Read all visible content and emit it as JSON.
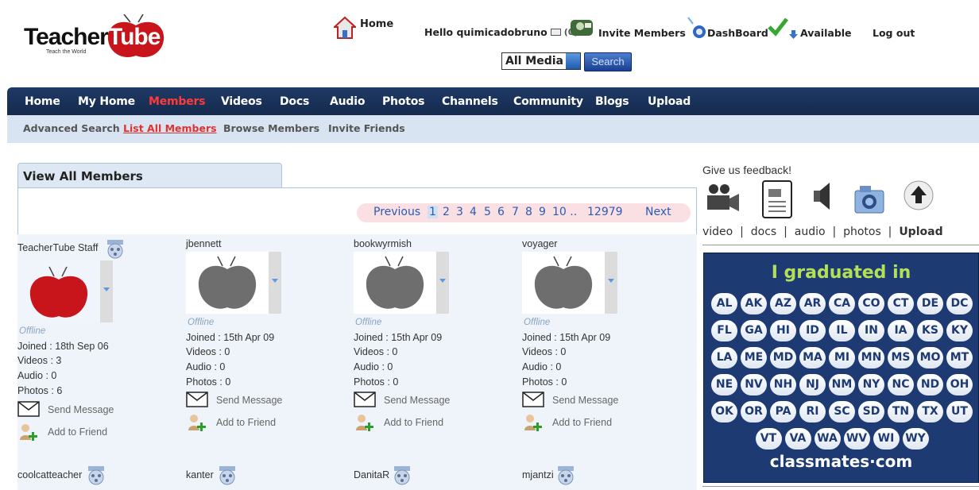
{
  "logo": {
    "text": "Teacher",
    "tube": "Tube",
    "tagline": "Teach the World"
  },
  "header": {
    "home": "Home",
    "hello": "Hello quimicadobruno",
    "mail_count": "(0)",
    "invite": "Invite Members",
    "dashboard": "DashBoard",
    "available": "Available",
    "logout": "Log out"
  },
  "search": {
    "media": "All Media",
    "button": "Search"
  },
  "nav": [
    "Home",
    "My Home",
    "Members",
    "Videos",
    "Docs",
    "Audio",
    "Photos",
    "Channels",
    "Community",
    "Blogs",
    "Upload"
  ],
  "subnav": [
    "Advanced Search",
    "List All Members",
    "Browse Members",
    "Invite Friends"
  ],
  "panel": {
    "title": "View All Members"
  },
  "pager": {
    "prev": "Previous",
    "pages": [
      "1",
      "2",
      "3",
      "4",
      "5",
      "6",
      "7",
      "8",
      "9",
      "10 ..",
      "12979"
    ],
    "next": "Next"
  },
  "labels": {
    "offline": "Offline",
    "send": "Send Message",
    "add": "Add to Friend"
  },
  "members": [
    {
      "name": "TeacherTube Staff",
      "joined": "Joined : 18th Sep 06",
      "videos": "Videos : 3",
      "audio": "Audio : 0",
      "photos": "Photos : 6",
      "avatar": "red"
    },
    {
      "name": "jbennett",
      "joined": "Joined : 15th Apr 09",
      "videos": "Videos : 0",
      "audio": "Audio : 0",
      "photos": "Photos : 0",
      "avatar": "gray"
    },
    {
      "name": "bookwyrmish",
      "joined": "Joined : 15th Apr 09",
      "videos": "Videos : 0",
      "audio": "Audio : 0",
      "photos": "Photos : 0",
      "avatar": "gray"
    },
    {
      "name": "voyager",
      "joined": "Joined : 15th Apr 09",
      "videos": "Videos : 0",
      "audio": "Audio : 0",
      "photos": "Photos : 0",
      "avatar": "gray"
    }
  ],
  "members_row2": [
    "coolcatteacher",
    "kanter",
    "DanitaR",
    "mjantzi"
  ],
  "sidebar": {
    "feedback": "Give us feedback!",
    "links": {
      "video": "video",
      "docs": "docs",
      "audio": "audio",
      "photos": "photos",
      "upload": "Upload"
    },
    "ad": {
      "title": "I graduated in",
      "states": [
        "AL",
        "AK",
        "AZ",
        "AR",
        "CA",
        "CO",
        "CT",
        "DE",
        "DC",
        "FL",
        "GA",
        "HI",
        "ID",
        "IL",
        "IN",
        "IA",
        "KS",
        "KY",
        "LA",
        "ME",
        "MD",
        "MA",
        "MI",
        "MN",
        "MS",
        "MO",
        "MT",
        "NE",
        "NV",
        "NH",
        "NJ",
        "NM",
        "NY",
        "NC",
        "ND",
        "OH",
        "OK",
        "OR",
        "PA",
        "RI",
        "SC",
        "SD",
        "TN",
        "TX",
        "UT",
        "VT",
        "VA",
        "WA",
        "WV",
        "WI",
        "WY"
      ],
      "brand": "classmates·com"
    }
  }
}
